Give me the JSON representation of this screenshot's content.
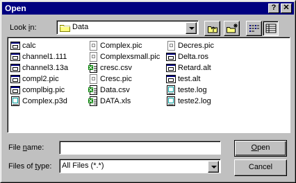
{
  "window": {
    "title": "Open"
  },
  "titlebar": {
    "help_glyph": "?",
    "close_glyph": "✕"
  },
  "lookin": {
    "label_prefix": "Look ",
    "label_accel": "i",
    "label_suffix": "n:",
    "value": "Data"
  },
  "toolbar": {
    "up_icon": "up-one-level-icon",
    "newfolder_icon": "new-folder-icon",
    "list_icon": "list-view-icon",
    "details_icon": "details-view-icon"
  },
  "files": [
    {
      "name": "calc",
      "icon": "exe-icon"
    },
    {
      "name": "channel1.111",
      "icon": "exe-icon"
    },
    {
      "name": "channel3.13a",
      "icon": "exe-icon"
    },
    {
      "name": "compl2.pic",
      "icon": "exe-icon"
    },
    {
      "name": "complbig.pic",
      "icon": "exe-icon"
    },
    {
      "name": "Complex.p3d",
      "icon": "document-icon"
    },
    {
      "name": "Complex.pic",
      "icon": "picture-icon"
    },
    {
      "name": "Complexsmall.pic",
      "icon": "picture-icon"
    },
    {
      "name": "cresc.csv",
      "icon": "spreadsheet-icon"
    },
    {
      "name": "Cresc.pic",
      "icon": "picture-icon"
    },
    {
      "name": "Data.csv",
      "icon": "spreadsheet-icon"
    },
    {
      "name": "DATA.xls",
      "icon": "spreadsheet-icon"
    },
    {
      "name": "Decres.pic",
      "icon": "picture-icon"
    },
    {
      "name": "Delta.ros",
      "icon": "exe-icon"
    },
    {
      "name": "Retard.alt",
      "icon": "exe-icon"
    },
    {
      "name": "test.alt",
      "icon": "exe-icon"
    },
    {
      "name": "teste.log",
      "icon": "document-icon"
    },
    {
      "name": "teste2.log",
      "icon": "document-icon"
    }
  ],
  "filename": {
    "label_prefix": "File ",
    "label_accel": "n",
    "label_suffix": "ame:",
    "value": ""
  },
  "filetype": {
    "label_prefix": "Files of ",
    "label_accel": "t",
    "label_suffix": "ype:",
    "value": "All Files (*.*)"
  },
  "buttons": {
    "open_accel": "O",
    "open_rest": "pen",
    "cancel": "Cancel"
  }
}
